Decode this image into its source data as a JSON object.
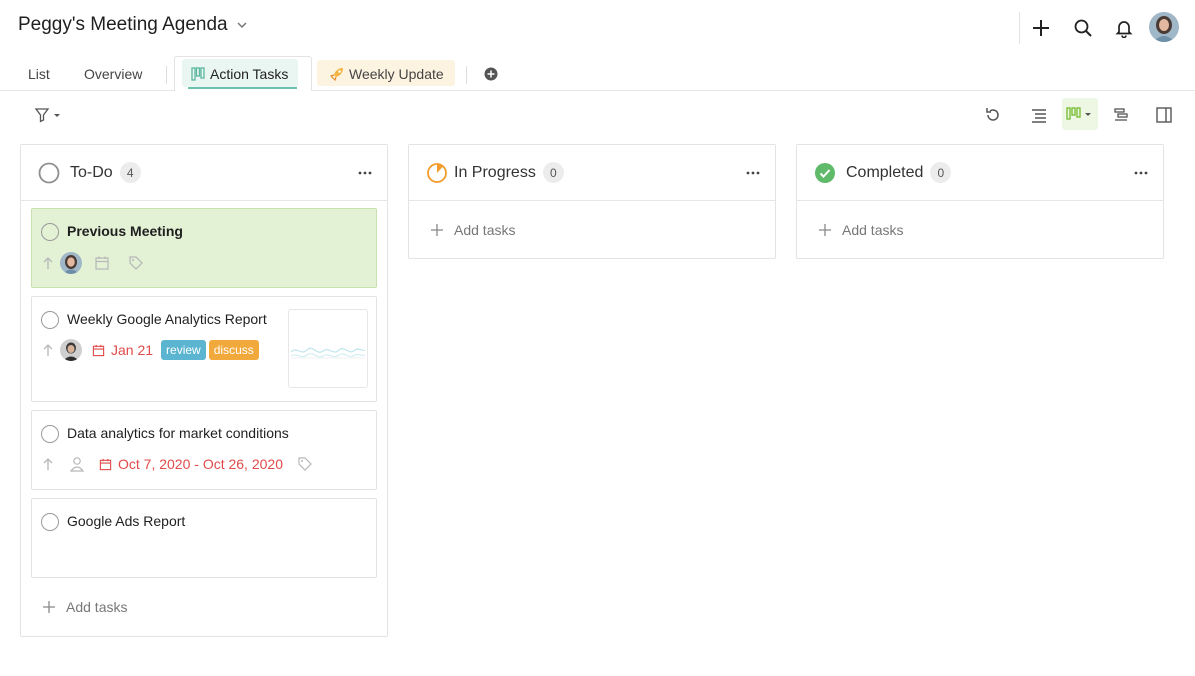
{
  "header": {
    "title": "Peggy's Meeting Agenda",
    "icons": [
      "add-icon",
      "search-icon",
      "bell-icon"
    ]
  },
  "tabs": [
    {
      "label": "List"
    },
    {
      "label": "Overview"
    },
    {
      "label": "Action Tasks",
      "icon": "board-icon",
      "active": true
    },
    {
      "label": "Weekly Update",
      "icon": "rocket-icon"
    }
  ],
  "toolbar": {
    "icons": [
      "filter-icon",
      "undo-icon",
      "list-view-icon",
      "board-view-icon",
      "gantt-view-icon",
      "side-panel-icon"
    ]
  },
  "columns": [
    {
      "name": "To-Do",
      "count": "4",
      "status_icon": "circle-empty-icon",
      "add_label": "Add tasks",
      "cards": [
        {
          "title": "Previous Meeting",
          "highlight": true
        },
        {
          "title": "Weekly Google Analytics Report",
          "date": "Jan 21",
          "tags": [
            {
              "label": "review",
              "color": "#5bb5d1"
            },
            {
              "label": "discuss",
              "color": "#f2a93b"
            }
          ]
        },
        {
          "title": "Data analytics for market conditions",
          "date": "Oct 7, 2020 - Oct 26, 2020"
        },
        {
          "title": "Google Ads Report"
        }
      ]
    },
    {
      "name": "In Progress",
      "count": "0",
      "status_icon": "progress-icon",
      "add_label": "Add tasks"
    },
    {
      "name": "Completed",
      "count": "0",
      "status_icon": "check-circle-icon",
      "add_label": "Add tasks"
    }
  ],
  "colors": {
    "accent_green": "#6cc3ad",
    "highlight_card": "#e3f1d5",
    "date_red": "#e14b4b",
    "progress_orange": "#f39c2b",
    "complete_green": "#5fba6a",
    "board_active": "#7bbf3a"
  }
}
